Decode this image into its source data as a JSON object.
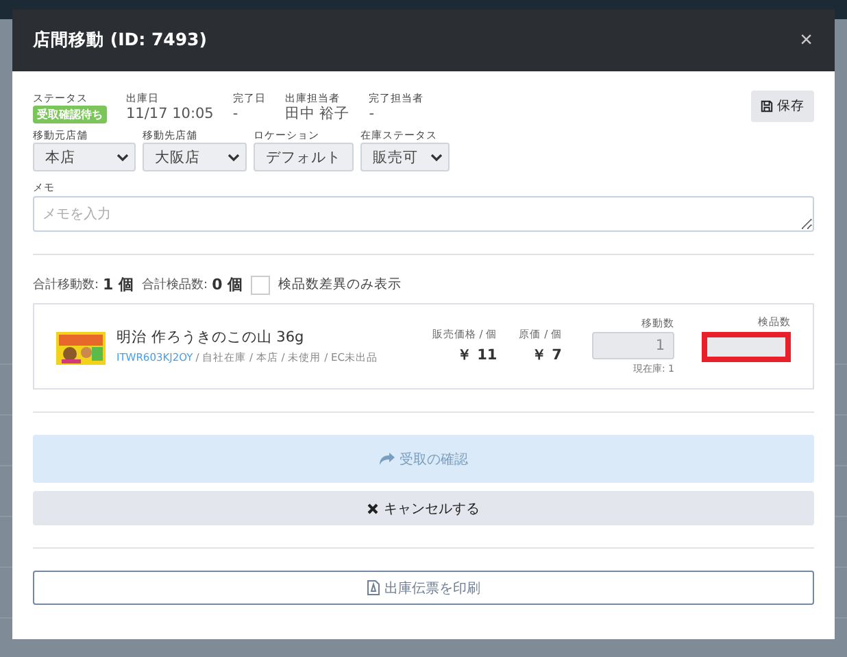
{
  "modal": {
    "title": "店間移動",
    "title_id": "(ID: 7493)",
    "close": "×",
    "info": [
      {
        "kind": "badge",
        "label": "ステータス",
        "value": "受取確認待ち"
      },
      {
        "kind": "text",
        "label": "出庫日",
        "value": "11/17 10:05"
      },
      {
        "kind": "text",
        "label": "完了日",
        "value": "-"
      },
      {
        "kind": "text",
        "label": "出庫担当者",
        "value": "田中 裕子"
      },
      {
        "kind": "text",
        "label": "完了担当者",
        "value": "-"
      }
    ],
    "save_button": "保存",
    "selects": [
      {
        "label": "移動元店舗",
        "value": "本店"
      },
      {
        "label": "移動先店舗",
        "value": "大阪店"
      },
      {
        "label": "ロケーション",
        "value": "デフォルト"
      },
      {
        "label": "在庫ステータス",
        "value": "販売可"
      }
    ],
    "memo": {
      "label": "メモ",
      "placeholder": "メモを入力"
    },
    "totals": [
      {
        "label": "合計移動数:",
        "value": "1 個"
      },
      {
        "label": "合計検品数:",
        "value": "0 個"
      }
    ],
    "diff_filter": {
      "label": "検品数差異のみ表示",
      "checked": false
    },
    "item": {
      "kind": "picture",
      "name": "明治 作ろうきのこの山 36g",
      "code": "ITWR603KJ2OY",
      "meta": "/ 自社在庫 / 本店 / 未使用 / EC未出品",
      "price_label": "販売価格 / 個",
      "price": "￥ 11",
      "cost_label": "原価 / 個",
      "cost": "￥ 7",
      "move_label": "移動数",
      "move_value": "1",
      "stock": "現在庫: 1",
      "inspect_label": "検品数",
      "inspect_highlighted": true
    },
    "confirm_button": "受取の確認",
    "cancel_button": "キャンセルする",
    "print_button": "出庫伝票を印刷"
  }
}
